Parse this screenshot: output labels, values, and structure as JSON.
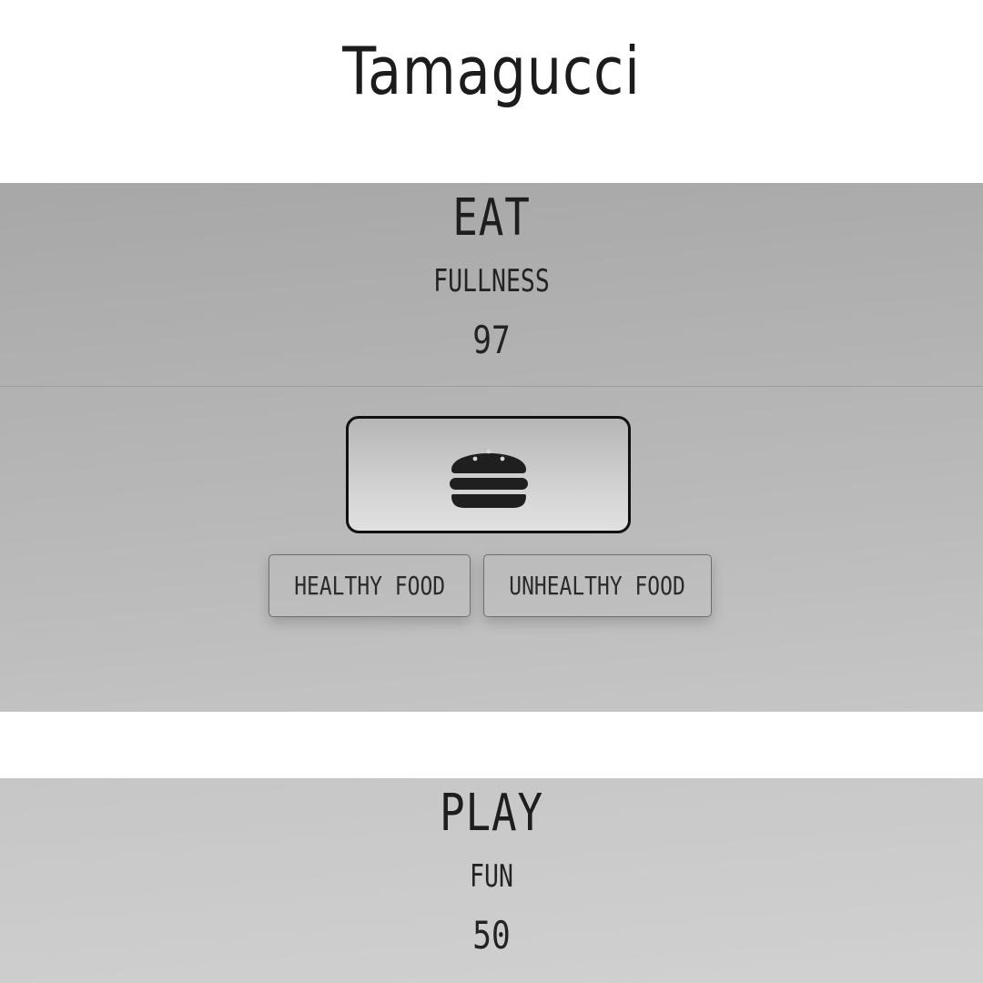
{
  "app": {
    "title": "Tamagucci"
  },
  "eat_panel": {
    "title": "EAT",
    "stat_label": "FULLNESS",
    "stat_value": "97",
    "action_icon": "burger-icon",
    "options": [
      {
        "label": "HEALTHY FOOD"
      },
      {
        "label": "UNHEALTHY FOOD"
      }
    ]
  },
  "play_panel": {
    "title": "PLAY",
    "stat_label": "FUN",
    "stat_value": "50"
  },
  "colors": {
    "background": "#ffffff",
    "text": "#1e1e1e",
    "icon": "#1f1f1f"
  }
}
